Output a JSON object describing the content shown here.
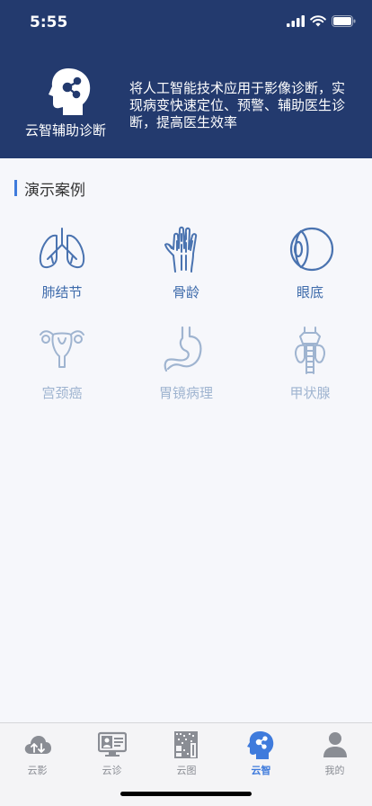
{
  "status": {
    "time": "5:55"
  },
  "hero": {
    "title": "云智辅助诊断",
    "description": "将人工智能技术应用于影像诊断，实现病变快速定位、预警、辅助医生诊断，提高医生效率"
  },
  "section": {
    "title": "演示案例"
  },
  "cases": [
    {
      "label": "肺结节",
      "icon": "lungs-icon",
      "enabled": true
    },
    {
      "label": "骨龄",
      "icon": "hand-bone-icon",
      "enabled": true
    },
    {
      "label": "眼底",
      "icon": "eye-icon",
      "enabled": true
    },
    {
      "label": "宫颈癌",
      "icon": "uterus-icon",
      "enabled": false
    },
    {
      "label": "胃镜病理",
      "icon": "stomach-icon",
      "enabled": false
    },
    {
      "label": "甲状腺",
      "icon": "thyroid-icon",
      "enabled": false
    }
  ],
  "colors": {
    "header_bg": "#233a6e",
    "accent": "#3f7bdc",
    "active_icon": "#3e6bab",
    "inactive_icon": "#9fb4d0"
  },
  "tabs": [
    {
      "label": "云影",
      "icon": "cloud-upload-icon",
      "selected": false
    },
    {
      "label": "云诊",
      "icon": "monitor-consult-icon",
      "selected": false
    },
    {
      "label": "云图",
      "icon": "qr-image-icon",
      "selected": false
    },
    {
      "label": "云智",
      "icon": "ai-head-icon",
      "selected": true
    },
    {
      "label": "我的",
      "icon": "user-icon",
      "selected": false
    }
  ]
}
